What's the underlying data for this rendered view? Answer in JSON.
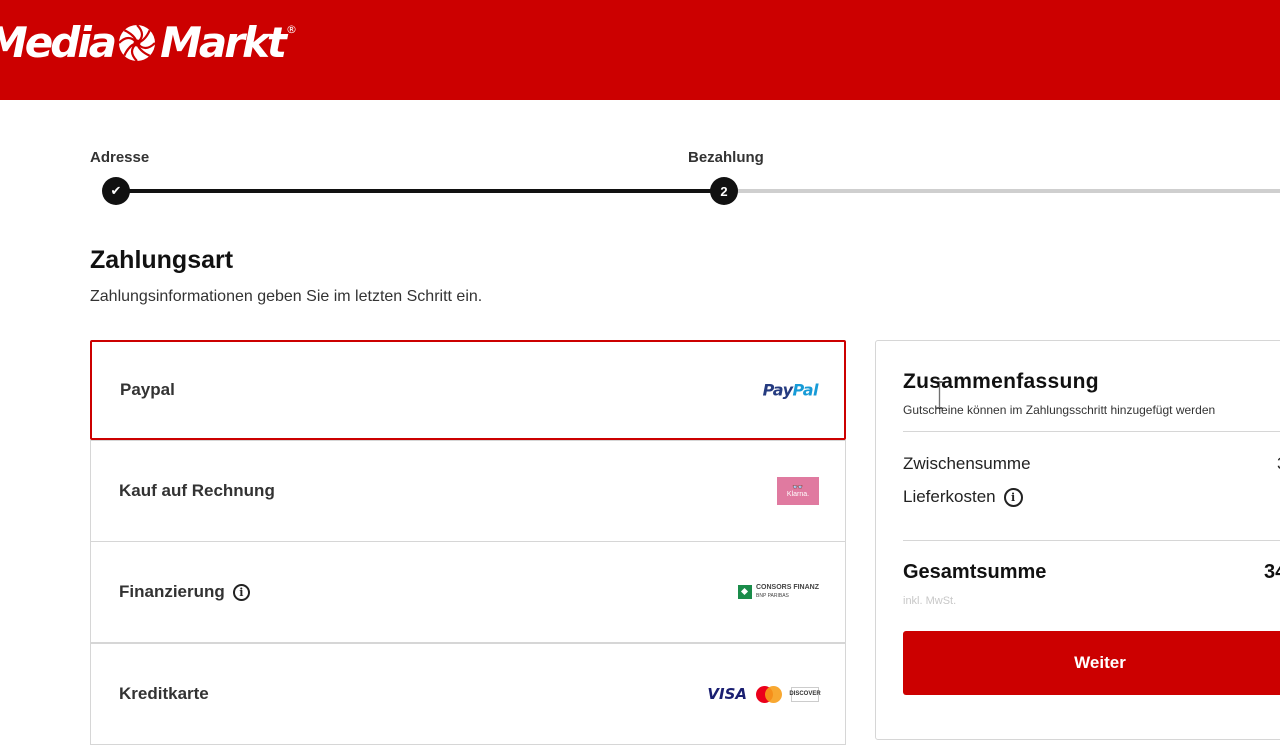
{
  "header": {
    "logo_text_left": "Media",
    "logo_text_right": "Markt",
    "logo_registered": "®",
    "color": "#cc0000"
  },
  "progress": {
    "steps": [
      {
        "label": "Adresse",
        "marker": "✔",
        "state": "done"
      },
      {
        "label": "Bezahlung",
        "marker": "2",
        "state": "current"
      }
    ]
  },
  "payment": {
    "title": "Zahlungsart",
    "subtitle": "Zahlungsinformationen geben Sie im letzten Schritt ein.",
    "options": [
      {
        "label": "Paypal",
        "logo": "paypal-logo",
        "logo_text_1": "Pay",
        "logo_text_2": "Pal",
        "selected": true
      },
      {
        "label": "Kauf auf Rechnung",
        "logo": "klarna-logo",
        "logo_text": "Klarna.",
        "logo_glyph": "👓"
      },
      {
        "label": "Finanzierung",
        "logo": "consors-finanz-logo",
        "logo_text": "CONSORS FINANZ",
        "logo_subtext": "BNP PARIBAS",
        "info_icon": "info-icon"
      },
      {
        "label": "Kreditkarte",
        "logo": "credit-card-logos",
        "visa_text": "VISA",
        "discover_text": "DISCOVER"
      }
    ]
  },
  "summary": {
    "title": "Zusammenfassung",
    "note": "Gutscheine können im Zahlungsschritt hinzugefügt werden",
    "subtotal_label": "Zwischensumme",
    "subtotal_value": "3",
    "shipping_label": "Lieferkosten",
    "total_label": "Gesamtsumme",
    "total_value": "34",
    "vat_note": "inkl. MwSt.",
    "continue_label": "Weiter"
  },
  "colors": {
    "accent": "#cc0000",
    "text": "#2a2a2a",
    "border": "#d6d6d6"
  }
}
